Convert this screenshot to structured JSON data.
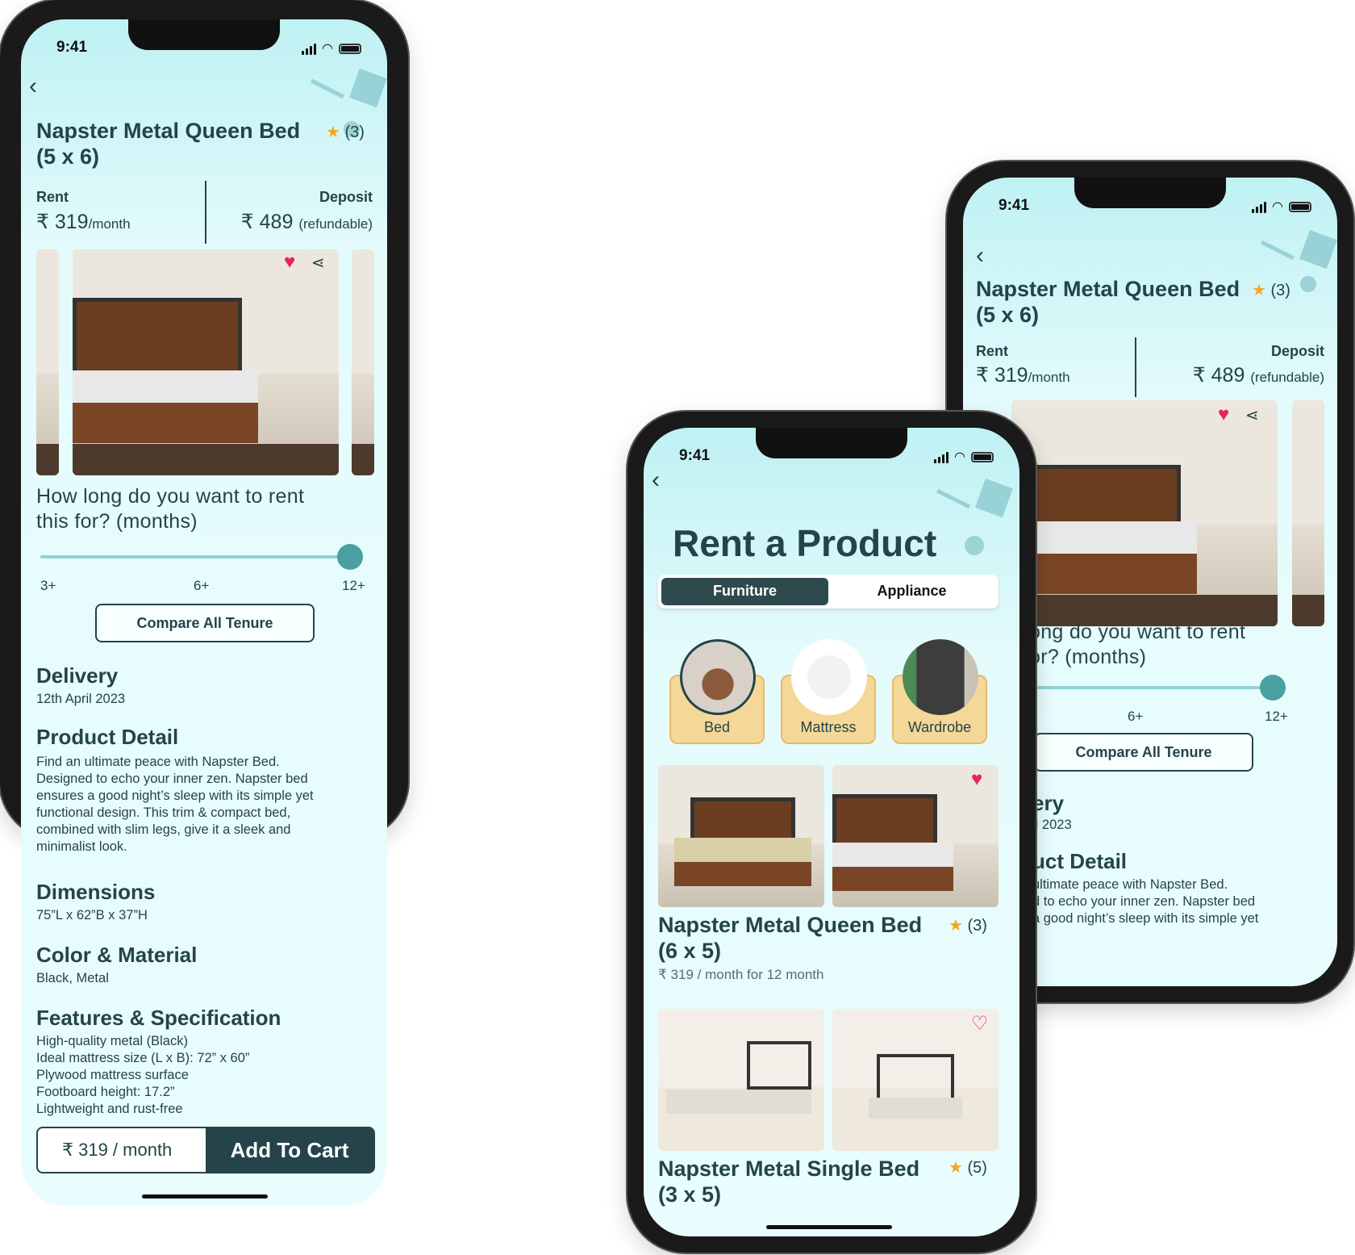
{
  "status_time": "9:41",
  "detail": {
    "title_line1": "Napster Metal Queen Bed",
    "title_line2": "(5 x 6)",
    "rating": "(3)",
    "rent_label": "Rent",
    "rent_value": "₹ 319",
    "rent_unit": "/month",
    "deposit_label": "Deposit",
    "deposit_value": "₹ 489",
    "deposit_unit": "(refundable)",
    "question_line1": "How long do you want to rent",
    "question_line2": "this for? (months)",
    "ticks": [
      "3+",
      "6+",
      "12+"
    ],
    "compare_label": "Compare All Tenure",
    "delivery_title": "Delivery",
    "delivery_date": "12th April 2023",
    "product_detail_title": "Product Detail",
    "product_detail_lines": [
      "Find an ultimate peace with Napster Bed.",
      "Designed to echo your inner zen. Napster bed",
      "ensures a good night’s sleep with its simple yet",
      "functional design. This trim & compact bed,",
      "combined with slim legs, give it a sleek and",
      "minimalist look."
    ],
    "dimensions_title": "Dimensions",
    "dimensions_value": "75”L x 62”B x 37”H",
    "color_title": "Color & Material",
    "color_value": "Black, Metal",
    "features_title": "Features & Specification",
    "features": [
      "High-quality metal (Black)",
      "Ideal mattress size (L x B): 72” x 60”",
      "Plywood mattress surface",
      "Footboard height: 17.2”",
      "Lightweight and rust-free"
    ],
    "cart_price": "₹ 319 / month",
    "cart_button": "Add To Cart"
  },
  "listing": {
    "title": "Rent a Product",
    "tabs": [
      "Furniture",
      "Appliance"
    ],
    "categories": [
      "Bed",
      "Mattress",
      "Wardrobe"
    ],
    "item1_line1": "Napster Metal Queen Bed",
    "item1_line2": "(6 x 5)",
    "item1_rating": "(3)",
    "item1_price": "₹ 319 / month for 12 month",
    "item2_line1": "Napster Metal Single Bed",
    "item2_line2": "(3 x 5)",
    "item2_rating": "(5)"
  },
  "right": {
    "q1": "ong do you want to rent",
    "q2": "or? (months)",
    "delivery_partial": "ery",
    "date_partial": "il 2023",
    "detail_partial": "uct Detail",
    "lines": [
      "ultimate peace with Napster Bed.",
      "d to echo your inner zen. Napster bed",
      "a good night’s sleep with its simple yet"
    ]
  },
  "colors": {
    "primary": "#244449",
    "accent_star": "#f4a623",
    "heart": "#e6245f",
    "slider": "#4a9fa1"
  },
  "icons": [
    "back-chevron-icon",
    "star-icon",
    "heart-icon",
    "share-icon",
    "signal-icon",
    "wifi-icon",
    "battery-icon"
  ]
}
